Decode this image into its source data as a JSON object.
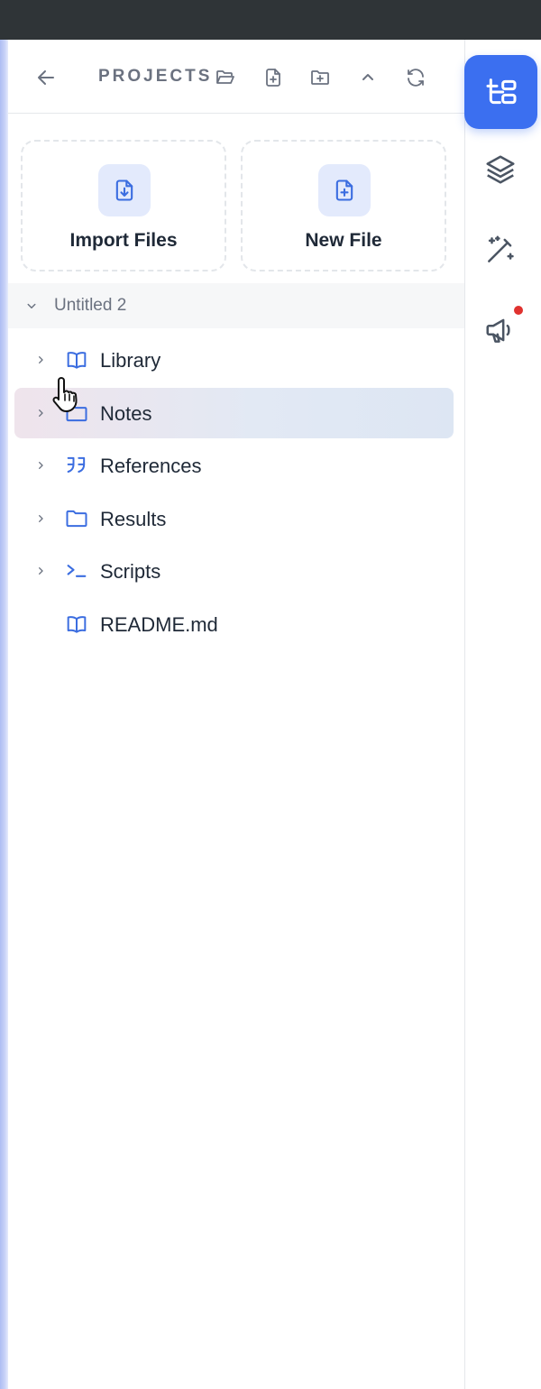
{
  "header": {
    "title": "PROJECTS",
    "back_icon": "arrow-left-icon",
    "actions": [
      "open-folder-icon",
      "new-file-icon",
      "new-folder-icon",
      "collapse-icon",
      "refresh-icon"
    ]
  },
  "cards": [
    {
      "label": "Import Files",
      "icon": "file-download-icon"
    },
    {
      "label": "New File",
      "icon": "file-plus-icon"
    }
  ],
  "project": {
    "name": "Untitled 2",
    "expanded": true
  },
  "tree": [
    {
      "label": "Library",
      "icon": "book-icon",
      "expandable": true
    },
    {
      "label": "Notes",
      "icon": "folder-icon",
      "expandable": true,
      "selected": true
    },
    {
      "label": "References",
      "icon": "quote-icon",
      "expandable": true
    },
    {
      "label": "Results",
      "icon": "folder-icon",
      "expandable": true
    },
    {
      "label": "Scripts",
      "icon": "terminal-icon",
      "expandable": true
    },
    {
      "label": "README.md",
      "icon": "book-icon",
      "expandable": false
    }
  ],
  "rail": {
    "items": [
      "file-tree-icon",
      "layers-icon",
      "magic-wand-icon",
      "megaphone-icon"
    ],
    "active": "file-tree-icon",
    "notification": true
  },
  "colors": {
    "accent": "#3b6ff0",
    "icon_blue": "#3b6de0",
    "notification": "#e0322f",
    "topbar": "#2f3437"
  }
}
